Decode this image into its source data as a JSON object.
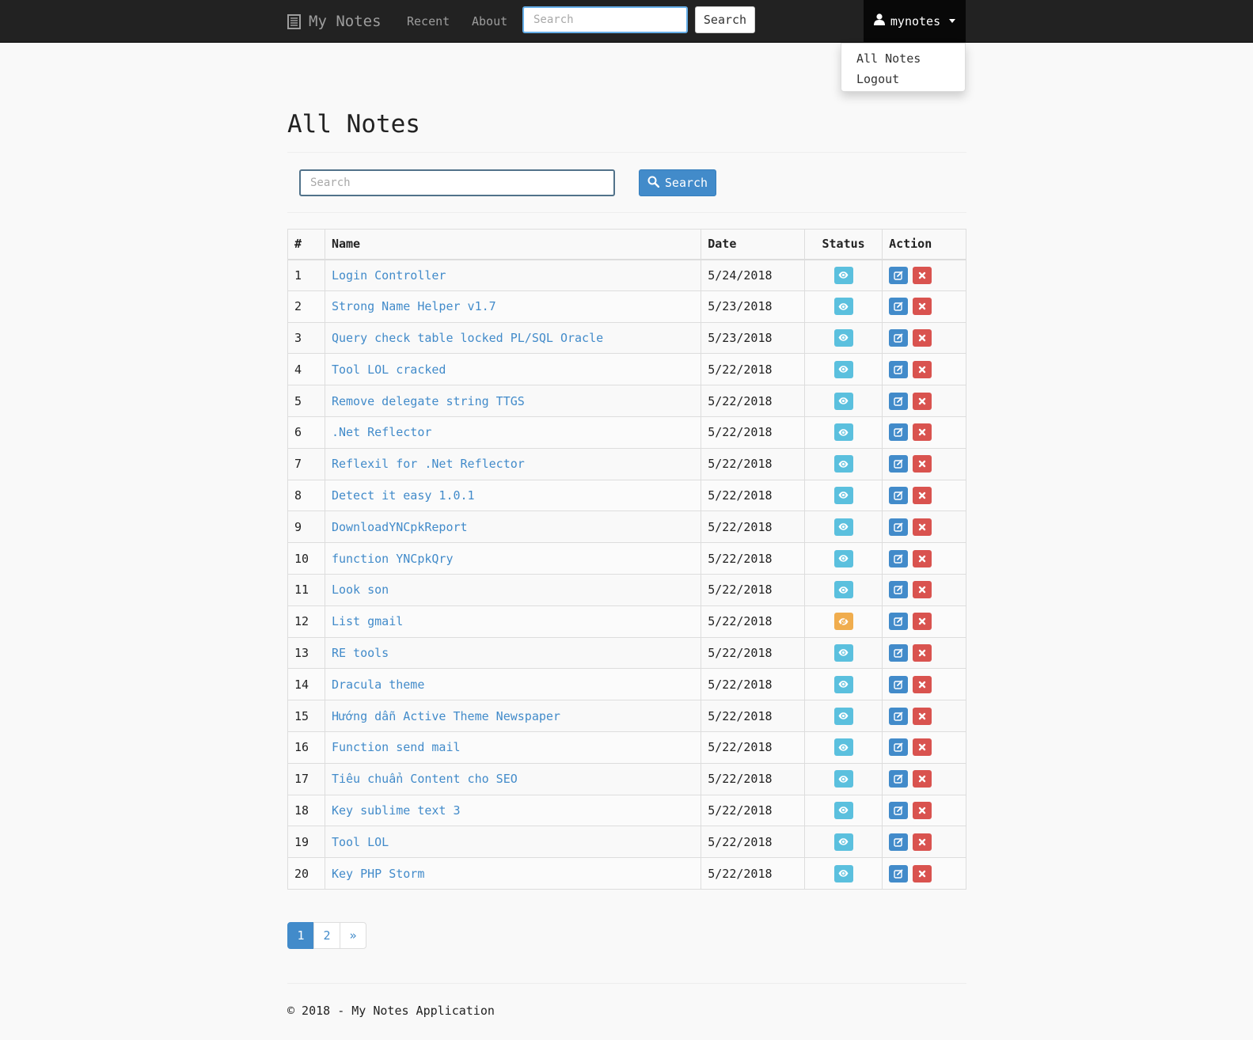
{
  "navbar": {
    "brand": "My Notes",
    "links": [
      "Recent",
      "About"
    ],
    "search_placeholder": "Search",
    "search_button": "Search",
    "user": "mynotes"
  },
  "user_dropdown": {
    "items": [
      "All Notes",
      "Logout"
    ]
  },
  "main": {
    "title": "All Notes",
    "search_placeholder": "Search",
    "search_button": "Search"
  },
  "table": {
    "headers": [
      "#",
      "Name",
      "Date",
      "Status",
      "Action"
    ],
    "rows": [
      {
        "num": "1",
        "name": "Login Controller",
        "date": "5/24/2018",
        "status": "visible"
      },
      {
        "num": "2",
        "name": "Strong Name Helper v1.7",
        "date": "5/23/2018",
        "status": "visible"
      },
      {
        "num": "3",
        "name": "Query check table locked PL/SQL Oracle",
        "date": "5/23/2018",
        "status": "visible"
      },
      {
        "num": "4",
        "name": "Tool LOL cracked",
        "date": "5/22/2018",
        "status": "visible"
      },
      {
        "num": "5",
        "name": "Remove delegate string TTGS",
        "date": "5/22/2018",
        "status": "visible"
      },
      {
        "num": "6",
        "name": ".Net Reflector",
        "date": "5/22/2018",
        "status": "visible"
      },
      {
        "num": "7",
        "name": "Reflexil for .Net Reflector",
        "date": "5/22/2018",
        "status": "visible"
      },
      {
        "num": "8",
        "name": "Detect it easy 1.0.1",
        "date": "5/22/2018",
        "status": "visible"
      },
      {
        "num": "9",
        "name": "DownloadYNCpkReport",
        "date": "5/22/2018",
        "status": "visible"
      },
      {
        "num": "10",
        "name": "function YNCpkQry",
        "date": "5/22/2018",
        "status": "visible"
      },
      {
        "num": "11",
        "name": "Look son",
        "date": "5/22/2018",
        "status": "visible"
      },
      {
        "num": "12",
        "name": "List gmail",
        "date": "5/22/2018",
        "status": "hidden"
      },
      {
        "num": "13",
        "name": "RE tools",
        "date": "5/22/2018",
        "status": "visible"
      },
      {
        "num": "14",
        "name": "Dracula theme",
        "date": "5/22/2018",
        "status": "visible"
      },
      {
        "num": "15",
        "name": "Hướng dẫn Active Theme Newspaper",
        "date": "5/22/2018",
        "status": "visible"
      },
      {
        "num": "16",
        "name": "Function send mail",
        "date": "5/22/2018",
        "status": "visible"
      },
      {
        "num": "17",
        "name": "Tiêu chuẩn Content cho SEO",
        "date": "5/22/2018",
        "status": "visible"
      },
      {
        "num": "18",
        "name": "Key sublime text 3",
        "date": "5/22/2018",
        "status": "visible"
      },
      {
        "num": "19",
        "name": "Tool LOL",
        "date": "5/22/2018",
        "status": "visible"
      },
      {
        "num": "20",
        "name": "Key PHP Storm",
        "date": "5/22/2018",
        "status": "visible"
      }
    ]
  },
  "pagination": {
    "pages": [
      "1",
      "2",
      "»"
    ],
    "active": "1"
  },
  "footer": {
    "text": "© 2018 - My Notes Application"
  },
  "colors": {
    "navbar": "#222222",
    "primary": "#428bca",
    "info": "#5bc0de",
    "warning": "#f0ad4e",
    "danger": "#d9534f"
  }
}
